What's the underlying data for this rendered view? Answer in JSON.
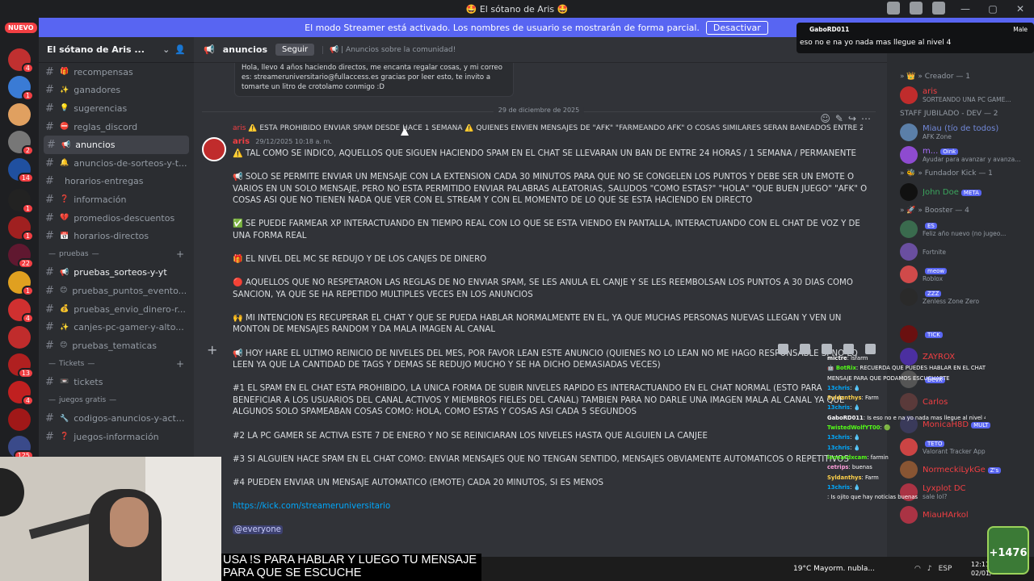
{
  "window": {
    "title": "🤩 El sótano de Aris 🤩",
    "controls": [
      "—",
      "▢",
      "✕"
    ]
  },
  "banner": {
    "text": "El modo Streamer está activado. Los nombres de usuario se mostrarán de forma parcial.",
    "button": "Desactivar"
  },
  "rail": {
    "new_label": "NUEVO",
    "badges": [
      "4",
      "1",
      "2",
      "14",
      "1",
      "1",
      "22",
      "1",
      "4",
      "1",
      "13",
      "4",
      "1",
      "125"
    ]
  },
  "sidebar": {
    "server_name": "El sótano de Aris ...",
    "channels": [
      {
        "emoji": "🎁",
        "label": "recompensas"
      },
      {
        "emoji": "✨",
        "label": "ganadores"
      },
      {
        "emoji": "💡",
        "label": "sugerencias"
      },
      {
        "emoji": "⛔",
        "label": "reglas_discord"
      },
      {
        "emoji": "📢",
        "label": "anuncios"
      },
      {
        "emoji": "🔔",
        "label": "anuncios-de-sorteos-y-t..."
      },
      {
        "emoji": "",
        "label": "horarios-entregas"
      },
      {
        "emoji": "❓",
        "label": "información"
      },
      {
        "emoji": "💔",
        "label": "promedios-descuentos"
      },
      {
        "emoji": "📅",
        "label": "horarios-directos"
      }
    ],
    "cat_pruebas": "pruebas",
    "pruebas_channels": [
      {
        "emoji": "📢",
        "label": "pruebas_sorteos-y-yt"
      },
      {
        "emoji": "😊",
        "label": "pruebas_puntos_evento..."
      },
      {
        "emoji": "💰",
        "label": "pruebas_envio_dinero-r..."
      },
      {
        "emoji": "✨",
        "label": "canjes-pc-gamer-y-alto..."
      },
      {
        "emoji": "😊",
        "label": "pruebas_tematicas"
      }
    ],
    "cat_tickets": "Tickets",
    "tickets_channels": [
      {
        "emoji": "📼",
        "label": "tickets"
      }
    ],
    "cat_juegos": "juegos gratis",
    "juegos_channels": [
      {
        "emoji": "🔧",
        "label": "codigos-anuncios-y-act..."
      },
      {
        "emoji": "❓",
        "label": "juegos-información"
      }
    ]
  },
  "chat": {
    "channel": "anuncios",
    "follow": "Seguir",
    "topic": "📢 | Anuncios sobre la comunidad!",
    "prev_message": "Hola, llevo 4 años haciendo directos, me encanta regalar cosas, y mi correo es: streameruniversitario@fullaccess.es gracias por leer esto, te invito a tomarte un litro de crotolamo conmigo :D",
    "date": "29 de diciembre de 2025",
    "reply_user": "aris",
    "reply_text": "⚠️ ESTA PROHIBIDO ENVIAR SPAM DESDE HACE 1 SEMANA ⚠️  QUIENES ENVIEN MENSAJES DE \"AFK\" \"FARMEANDO AFK\" O COSAS SIMILARES SERAN BANEADOS ENTRE 24 HOR...",
    "author": "aris",
    "timestamp": "29/12/2025 10:18 a. m.",
    "paragraphs": [
      "⚠️ TAL COMO SE INDICO, AQUELLOS QUE SIGUEN HACIENDO SPAM EN EL CHAT SE LLEVARAN UN BAN DE ENTRE 24 HORAS / 1 SEMANA / PERMANENTE",
      "📢 SOLO SE PERMITE ENVIAR UN MENSAJE CON LA EXTENSION CADA 30 MINUTOS PARA QUE NO SE CONGELEN LOS PUNTOS Y DEBE SER UN EMOTE O VARIOS EN UN SOLO MENSAJE, PERO NO ESTA PERMITIDO ENVIAR PALABRAS ALEATORIAS, SALUDOS \"COMO ESTAS?\" \"HOLA\" \"QUE BUEN JUEGO\" \"AFK\" O COSAS ASI QUE NO TIENEN NADA QUE VER CON EL STREAM Y CON EL MOMENTO DE LO QUE SE ESTA HACIENDO EN DIRECTO",
      "✅ SE PUEDE FARMEAR XP INTERACTUANDO EN TIEMPO REAL CON LO QUE SE ESTA VIENDO EN PANTALLA, INTERACTUANDO CON EL CHAT DE VOZ Y DE UNA FORMA REAL",
      "🎁 EL NIVEL DEL MC SE REDUJO Y DE LOS CANJES DE DINERO",
      "🔴 AQUELLOS QUE NO RESPETARON LAS REGLAS DE NO ENVIAR SPAM, SE LES ANULA EL CANJE Y SE LES REEMBOLSAN LOS PUNTOS A 30 DIAS COMO SANCION, YA QUE SE HA REPETIDO MULTIPLES VECES EN LOS ANUNCIOS",
      "🙌 MI INTENCION ES RECUPERAR EL CHAT Y QUE SE PUEDA HABLAR NORMALMENTE EN EL, YA QUE MUCHAS PERSONAS NUEVAS LLEGAN Y VEN UN MONTON DE MENSAJES RANDOM Y DA MALA IMAGEN AL CANAL",
      "📢 HOY HARE EL ULTIMO REINICIO DE NIVELES DEL MES, POR FAVOR LEAN ESTE ANUNCIO (QUIENES NO LO LEAN NO ME HAGO RESPONSABLE SI NO LO LEEN YA QUE LA CANTIDAD DE TAGS Y DEMAS SE REDUJO MUCHO Y SE HA DICHO DEMASIADAS VECES)",
      "#1 EL SPAM EN EL CHAT ESTA PROHIBIDO, LA UNICA FORMA DE SUBIR NIVELES RAPIDO ES INTERACTUANDO EN EL CHAT NORMAL (ESTO PARA BENEFICIAR A LOS USUARIOS DEL CANAL ACTIVOS Y MIEMBROS FIELES DEL CANAL) TAMBIEN PARA NO DARLE UNA IMAGEN MALA AL CANAL YA QUE ALGUNOS SOLO SPAMEABAN COSAS COMO: HOLA, COMO ESTAS Y COSAS ASI CADA 5 SEGUNDOS",
      "#2 LA PC GAMER SE ACTIVA ESTE 7 DE ENERO Y NO SE REINICIARAN LOS NIVELES HASTA QUE ALGUIEN LA CANJEE",
      "#3 SI ALGUIEN HACE SPAM EN EL CHAT COMO: ENVIAR MENSAJES QUE NO TENGAN SENTIDO, MENSAJES OBVIAMENTE AUTOMATICOS O REPETITIVOS",
      "#4 PUEDEN ENVIAR UN MENSAJE AUTOMATICO (EMOTE) CADA 20 MINUTOS, SI ES MENOS"
    ],
    "link": "https://kick.com/streameruniversitario",
    "mention": "@everyone"
  },
  "members": {
    "groups": [
      {
        "title": "» 👑 » Creador — 1",
        "members": [
          {
            "name": "aris",
            "status": "SORTEANDO UNA PC GAME...",
            "color": "#f23f43",
            "av": "#c02c2c",
            "tag": ""
          }
        ]
      },
      {
        "title": "STAFF JUBILADO - DEV — 2",
        "members": [
          {
            "name": "Miau (tío de todos)",
            "status": "AFK Zone",
            "color": "#7289da",
            "av": "#5b7fa8",
            "tag": ""
          },
          {
            "name": "m...",
            "status": "Ayudar para avanzar y avanza...",
            "color": "#a970ff",
            "av": "#8e4bd0",
            "tag": "Oink"
          }
        ]
      },
      {
        "title": "» 🐝 » Fundador Kick — 1",
        "members": [
          {
            "name": "John Doe",
            "status": "",
            "color": "#3ba55d",
            "av": "#111111",
            "tag": "META"
          }
        ]
      },
      {
        "title": "» 🚀 » Booster — 4",
        "members": [
          {
            "name": "",
            "status": "Feliz año nuevo (no jugeo...",
            "color": "#f47fff",
            "av": "#3a6b4e",
            "tag": "ES"
          },
          {
            "name": "",
            "status": "Fortnite",
            "color": "#f47fff",
            "av": "#6a4fa0",
            "tag": ""
          },
          {
            "name": "",
            "status": "Roblox",
            "color": "#f47fff",
            "av": "#d04a4a",
            "tag": "meow"
          },
          {
            "name": "",
            "status": "Zenless Zone Zero",
            "color": "#f47fff",
            "av": "#2a2a2a",
            "tag": "ZZZ"
          }
        ]
      }
    ],
    "lower": [
      {
        "name": "",
        "status": "",
        "color": "#f23f43",
        "av": "#6a1010",
        "tag": "TICK"
      },
      {
        "name": "ZAYROX",
        "status": "",
        "color": "#f23f43",
        "av": "#4b2fa0",
        "tag": ""
      },
      {
        "name": "",
        "status": "",
        "color": "#f23f43",
        "av": "#555555",
        "tag": "DevX"
      },
      {
        "name": "Carlos",
        "status": "",
        "color": "#f23f43",
        "av": "#5a3a3a",
        "tag": ""
      },
      {
        "name": "MonicaH8D",
        "status": "",
        "color": "#f23f43",
        "av": "#3a3a5a",
        "tag": "MULT"
      },
      {
        "name": "",
        "status": "Valorant Tracker App",
        "color": "#f23f43",
        "av": "#cc4444",
        "tag": "TETO"
      },
      {
        "name": "NormeckiLykGe",
        "status": "",
        "color": "#f23f43",
        "av": "#885533",
        "tag": "Z's"
      },
      {
        "name": "Lyxplot DC",
        "status": "sale lol?",
        "color": "#f23f43",
        "av": "#aa3344",
        "tag": ""
      },
      {
        "name": "MiauHArkol",
        "status": "",
        "color": "#f23f43",
        "av": "#aa3344",
        "tag": ""
      }
    ]
  },
  "alert": {
    "user": "GaboRD011",
    "label": "Male",
    "message": "eso no e na yo nada mas llegue al nivel 4"
  },
  "stream_chat": [
    {
      "u": "mictre",
      "m": ": lsfarm",
      "c": "#ffffff"
    },
    {
      "u": "🤖 BotRix",
      "m": ": RECUERDA QUE PUEDES HABLAR EN EL CHAT CON !s Y TU",
      "c": "#53fc18"
    },
    {
      "u": "",
      "m": "MENSAJE PARA QUE PODAMOS ESCUCHARTE",
      "c": "#ffffff"
    },
    {
      "u": "13chris",
      "m": ": 💧",
      "c": "#00a8fc"
    },
    {
      "u": "Syldanthys",
      "m": ": Farm",
      "c": "#ffd24a"
    },
    {
      "u": "13chris",
      "m": ": 💧",
      "c": "#00a8fc"
    },
    {
      "u": "GaboRD011",
      "m": ": Is eso no e na yo nada mas llegue al nivel 4",
      "c": "#ffffff"
    },
    {
      "u": "TwistedWolfYT00",
      "m": ": 🟢",
      "c": "#53fc18"
    },
    {
      "u": "13chris",
      "m": ": 💧",
      "c": "#00a8fc"
    },
    {
      "u": "13chris",
      "m": ": 💧",
      "c": "#00a8fc"
    },
    {
      "u": "leonardxcam",
      "m": ": farmin",
      "c": "#53fc18"
    },
    {
      "u": "cetrips",
      "m": ": buenas",
      "c": "#ff9fdc"
    },
    {
      "u": "Syldanthys",
      "m": ": Farm",
      "c": "#ffd24a"
    },
    {
      "u": "13chris",
      "m": ": 💧",
      "c": "#00a8fc"
    },
    {
      "u": "",
      "m": ": Is ojito que hay noticias buenas",
      "c": "#f23f43"
    }
  ],
  "caption": {
    "line1": "USA !S PARA HABLAR Y LUEGO TU MENSAJE",
    "line2": "PARA QUE SE ESCUCHE"
  },
  "taskbar": {
    "weather": "19°C  Mayorm. nubla...",
    "lang": "ESP",
    "time": "12:11",
    "date": "02/01/"
  },
  "kick_widget": "+1476"
}
